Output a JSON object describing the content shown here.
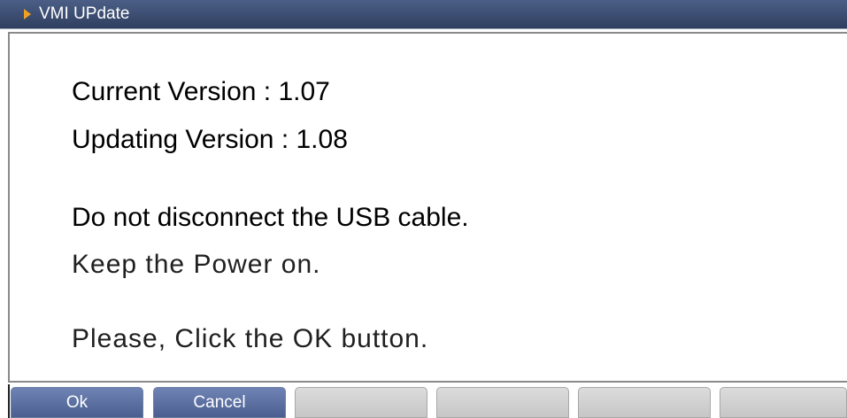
{
  "window": {
    "title": "VMI UPdate"
  },
  "content": {
    "current_version_line": "Current Version : 1.07",
    "updating_version_line": "Updating Version : 1.08",
    "warning_line": "Do not disconnect the USB cable.",
    "power_line": "Keep the Power on.",
    "instruction_line": "Please, Click the OK button."
  },
  "buttons": {
    "ok_label": "Ok",
    "cancel_label": "Cancel"
  },
  "colors": {
    "titlebar": "#3a4a6e",
    "title_arrow": "#f0a020",
    "active_button": "#5a6fa0",
    "empty_button": "#d0d0d0"
  },
  "icons": {
    "title_marker": "triangle-right-icon"
  }
}
